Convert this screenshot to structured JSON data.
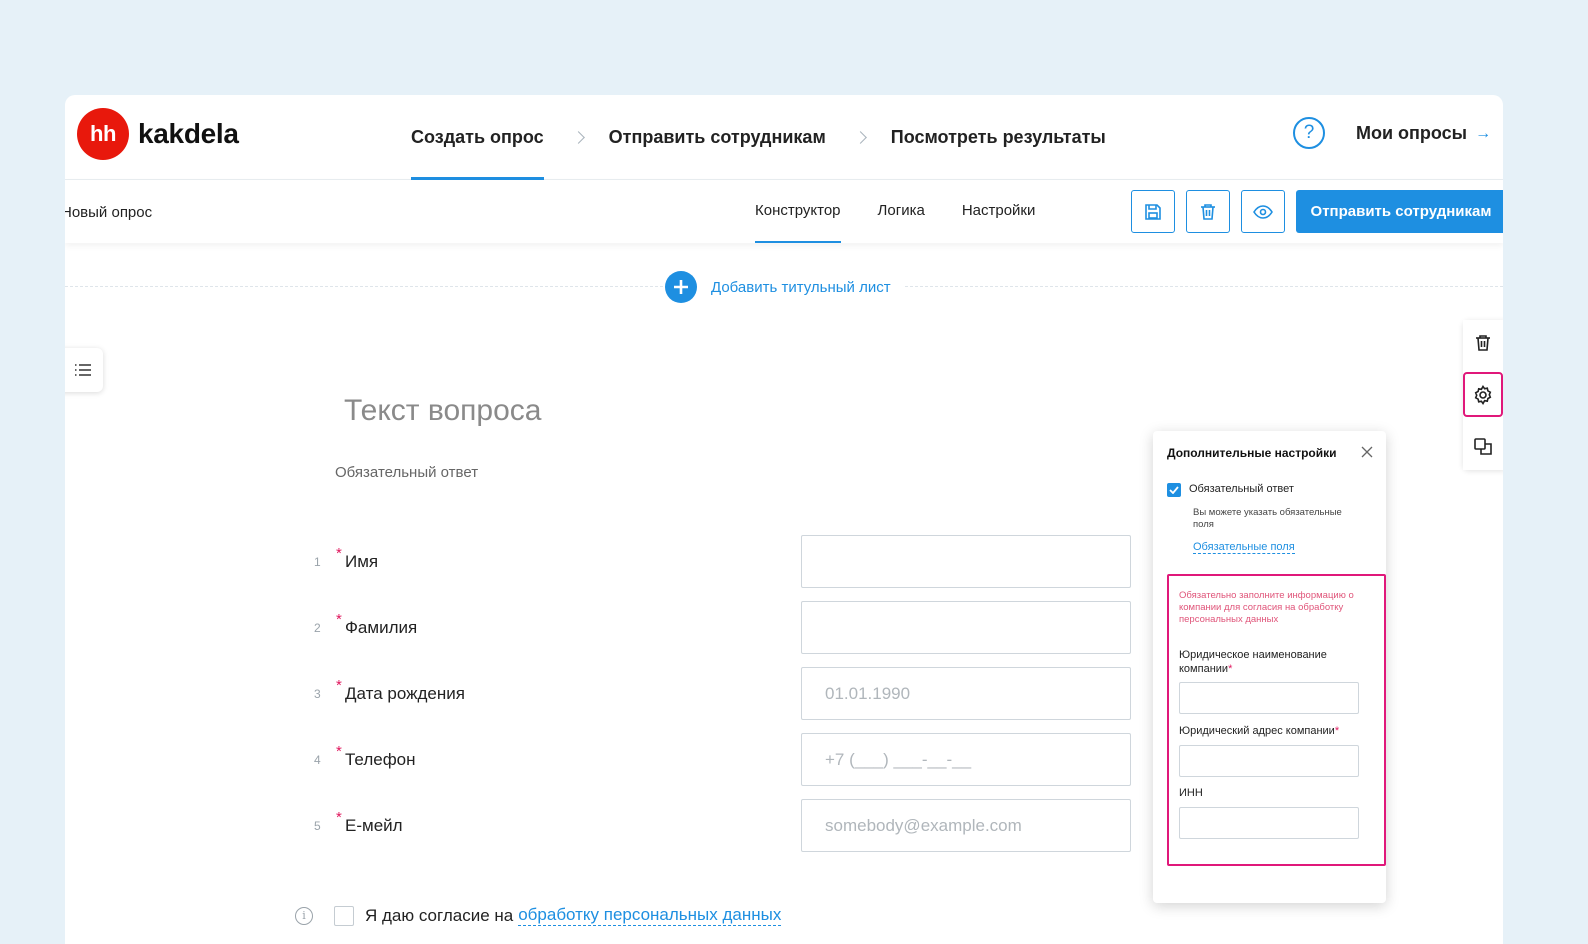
{
  "brand": {
    "badge": "hh",
    "name": "kakdela"
  },
  "steps": [
    "Создать опрос",
    "Отправить сотрудникам",
    "Посмотреть результаты"
  ],
  "header": {
    "help": "?",
    "my_surveys": "Мои опросы",
    "arrow": "→"
  },
  "toolbar": {
    "survey_name": "Новый опрос",
    "tabs": [
      "Конструктор",
      "Логика",
      "Настройки"
    ],
    "send_label": "Отправить сотрудникам"
  },
  "canvas": {
    "add_title": "Добавить титульный лист"
  },
  "question": {
    "title": "Текст вопроса",
    "required_text": "Обязательный ответ",
    "fields": [
      {
        "num": "1",
        "label": "Имя",
        "placeholder": ""
      },
      {
        "num": "2",
        "label": "Фамилия",
        "placeholder": ""
      },
      {
        "num": "3",
        "label": "Дата рождения",
        "placeholder": "01.01.1990"
      },
      {
        "num": "4",
        "label": "Телефон",
        "placeholder": "+7 (___) ___-__-__"
      },
      {
        "num": "5",
        "label": "Е-мейл",
        "placeholder": "somebody@example.com"
      }
    ],
    "star": "*",
    "consent_text": "Я даю согласие на",
    "consent_link": "обработку персональных данных"
  },
  "settings_popover": {
    "title": "Дополнительные настройки",
    "required_label": "Обязательный ответ",
    "hint": "Вы можете указать обязательные поля",
    "link": "Обязательные поля",
    "company_warning": "Обязательно заполните информацию о компании для согласия на обработку персональных данных",
    "company_name_label": "Юридическое наименование компании",
    "company_address_label": "Юридический адрес компании",
    "inn_label": "ИНН",
    "star": "*"
  },
  "colors": {
    "accent": "#1e8fe1",
    "brand_red": "#e8180c",
    "highlight": "#e0187a"
  }
}
